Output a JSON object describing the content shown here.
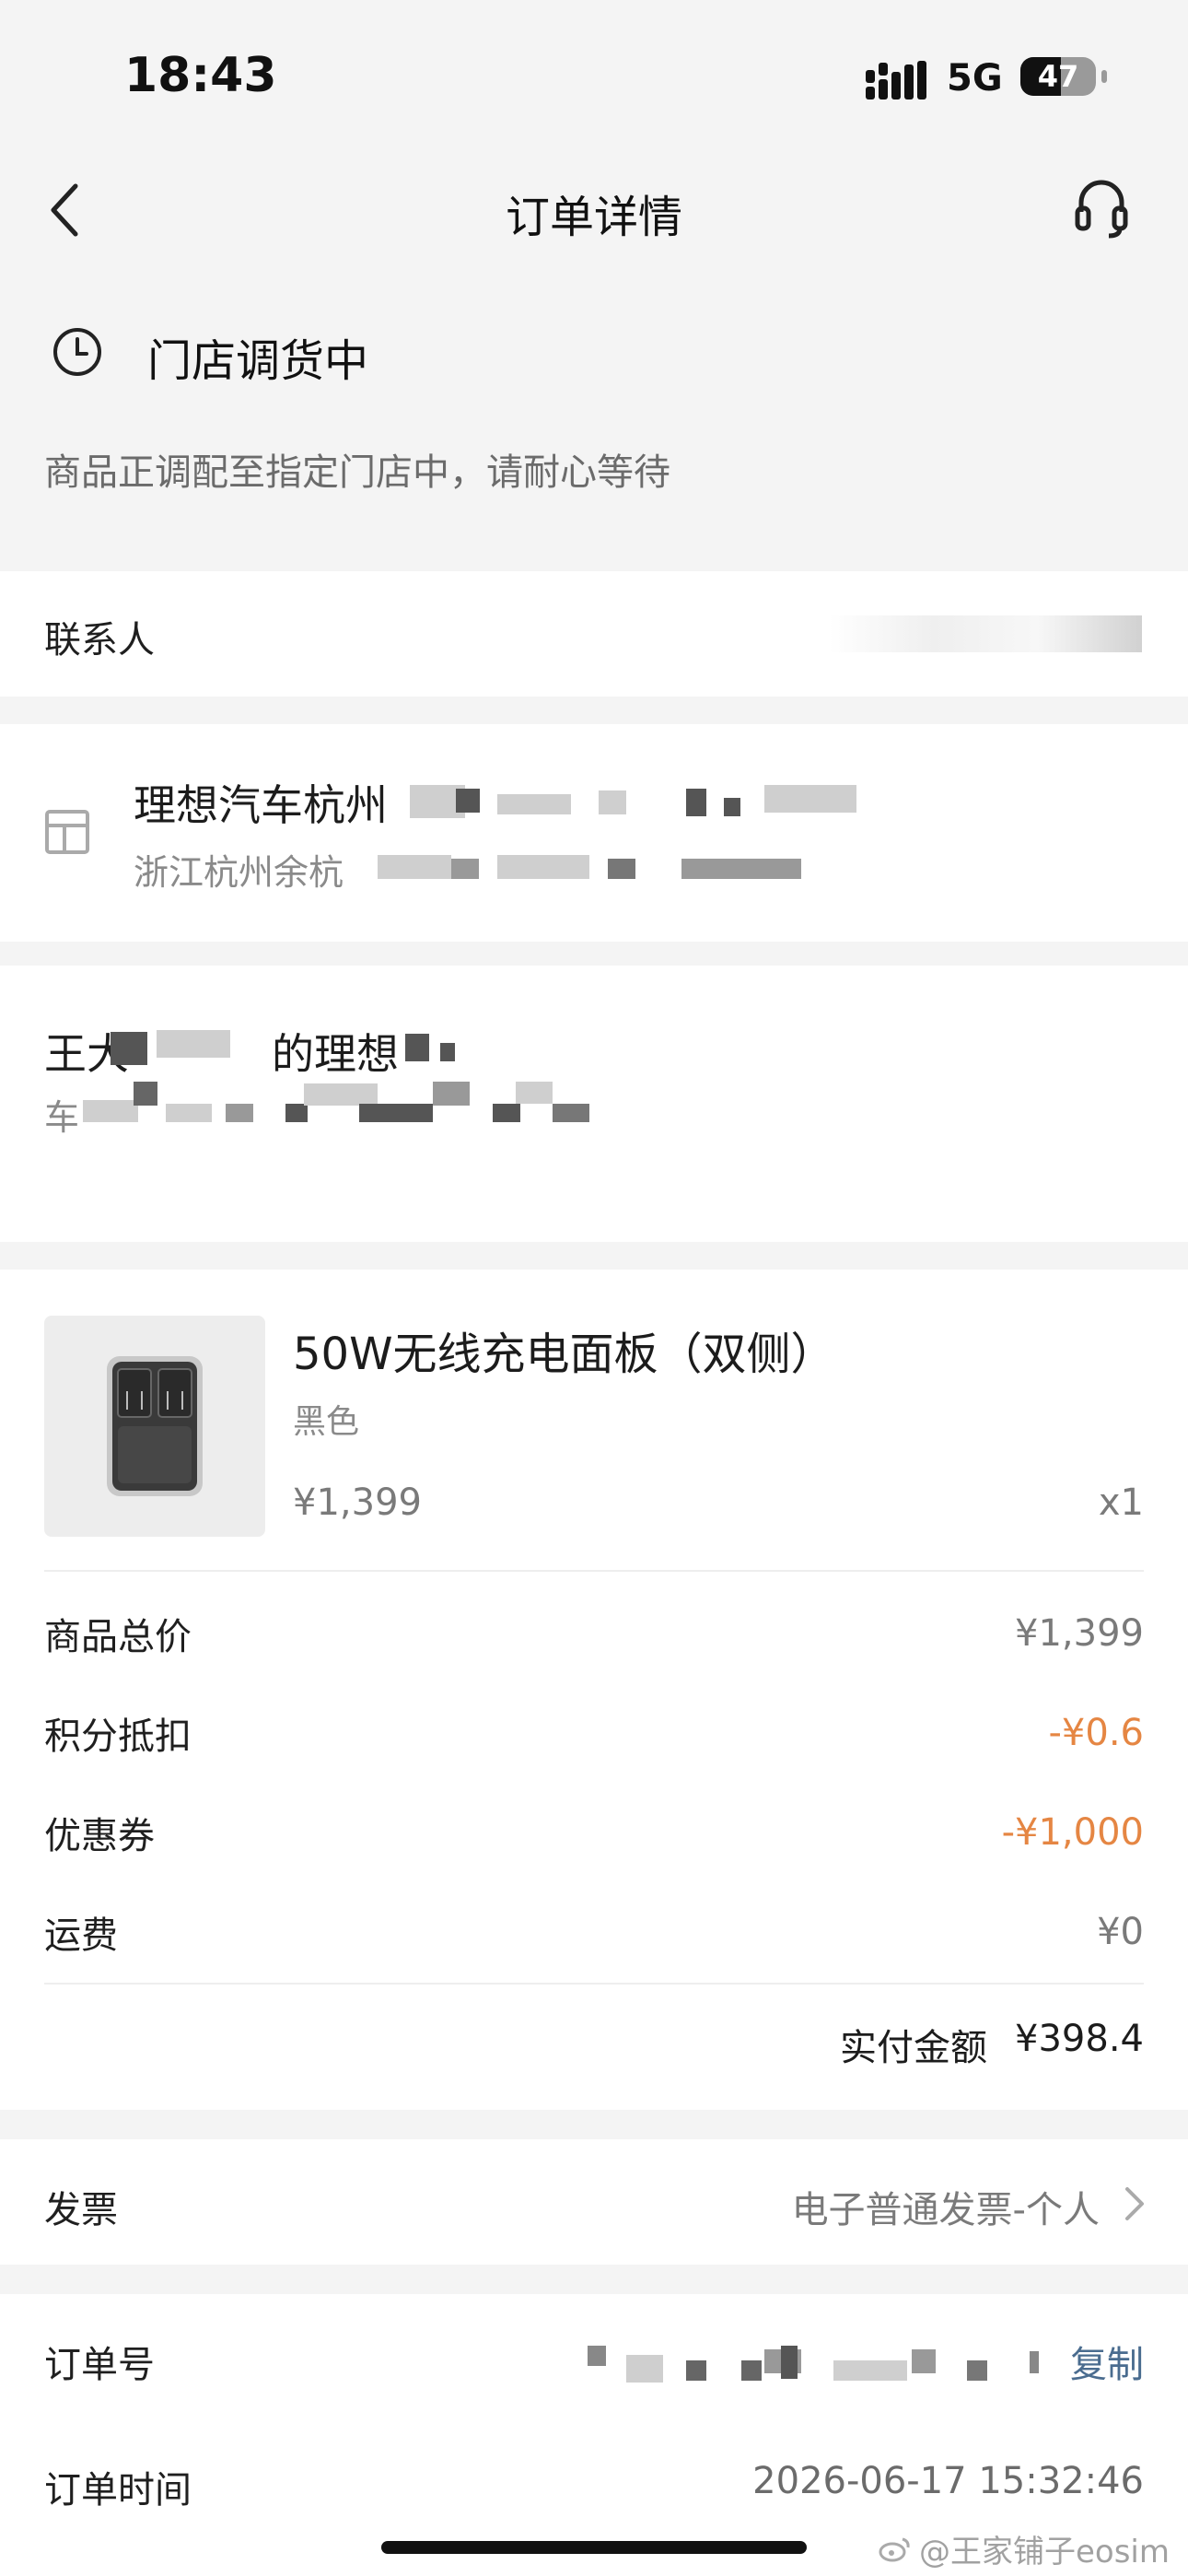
{
  "status_bar": {
    "time": "18:43",
    "network": "5G",
    "battery": "47"
  },
  "nav": {
    "title": "订单详情",
    "back_icon": "chevron-left-icon",
    "support_icon": "headset-icon"
  },
  "order_status": {
    "title": "门店调货中",
    "description": "商品正调配至指定门店中，请耐心等待"
  },
  "contact": {
    "label": "联系人"
  },
  "store": {
    "name_prefix": "理想汽车杭州",
    "address_prefix": "浙江杭州余杭"
  },
  "vehicle": {
    "name_prefix": "王大",
    "name_suffix": "的理想",
    "plate_prefix": "车"
  },
  "product": {
    "name": "50W无线充电面板（双侧）",
    "variant": "黑色",
    "price": "¥1,399",
    "quantity": "x1"
  },
  "price_summary": {
    "rows": [
      {
        "label": "商品总价",
        "value": "¥1,399",
        "highlight": false
      },
      {
        "label": "积分抵扣",
        "value": "-¥0.6",
        "highlight": true
      },
      {
        "label": "优惠券",
        "value": "-¥1,000",
        "highlight": true
      },
      {
        "label": "运费",
        "value": "¥0",
        "highlight": false
      }
    ],
    "paid_label": "实付金额",
    "paid_value": "¥398.4"
  },
  "invoice": {
    "label": "发票",
    "value": "电子普通发票-个人"
  },
  "order_info": {
    "number_label": "订单号",
    "copy_label": "复制",
    "time_label": "订单时间",
    "time_value": "2026-06-17 15:32:46"
  },
  "watermark": "@王家铺子eosim",
  "colors": {
    "accent_orange": "#e58643",
    "link_blue": "#4a6c8f"
  }
}
